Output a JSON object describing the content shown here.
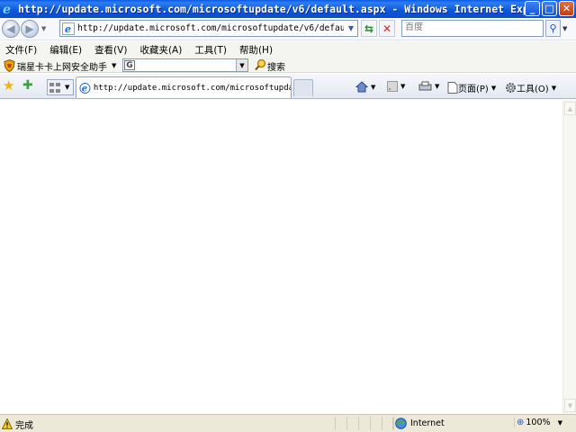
{
  "window": {
    "title": "http://update.microsoft.com/microsoftupdate/v6/default.aspx - Windows Internet Explorer",
    "controls": {
      "minimize": "_",
      "maximize": "□",
      "close": "✕"
    }
  },
  "navbar": {
    "back_label": "◀",
    "forward_label": "▶",
    "address_value": "http://update.microsoft.com/microsoftupdate/v6/default.aspx",
    "search_placeholder": "百度",
    "refresh_glyph": "⇆",
    "stop_glyph": "✕"
  },
  "menubar": {
    "items": [
      {
        "label": "文件(F)"
      },
      {
        "label": "编辑(E)"
      },
      {
        "label": "查看(V)"
      },
      {
        "label": "收藏夹(A)"
      },
      {
        "label": "工具(T)"
      },
      {
        "label": "帮助(H)"
      }
    ]
  },
  "addon_toolbar": {
    "label": "瑞星卡卡上网安全助手",
    "search_engine_glyph": "G",
    "search_button_label": "搜索"
  },
  "tabbar": {
    "active_tab_label": "http://update.microsoft.com/microsoftupda...",
    "page_menu_label": "页面(P)",
    "tools_menu_label": "工具(O)"
  },
  "statusbar": {
    "text": "完成",
    "zone": "Internet",
    "zoom": "100%"
  },
  "colors": {
    "titlebar": "#0a5ae6",
    "chrome": "#ece9d8",
    "content": "#ffffff"
  }
}
